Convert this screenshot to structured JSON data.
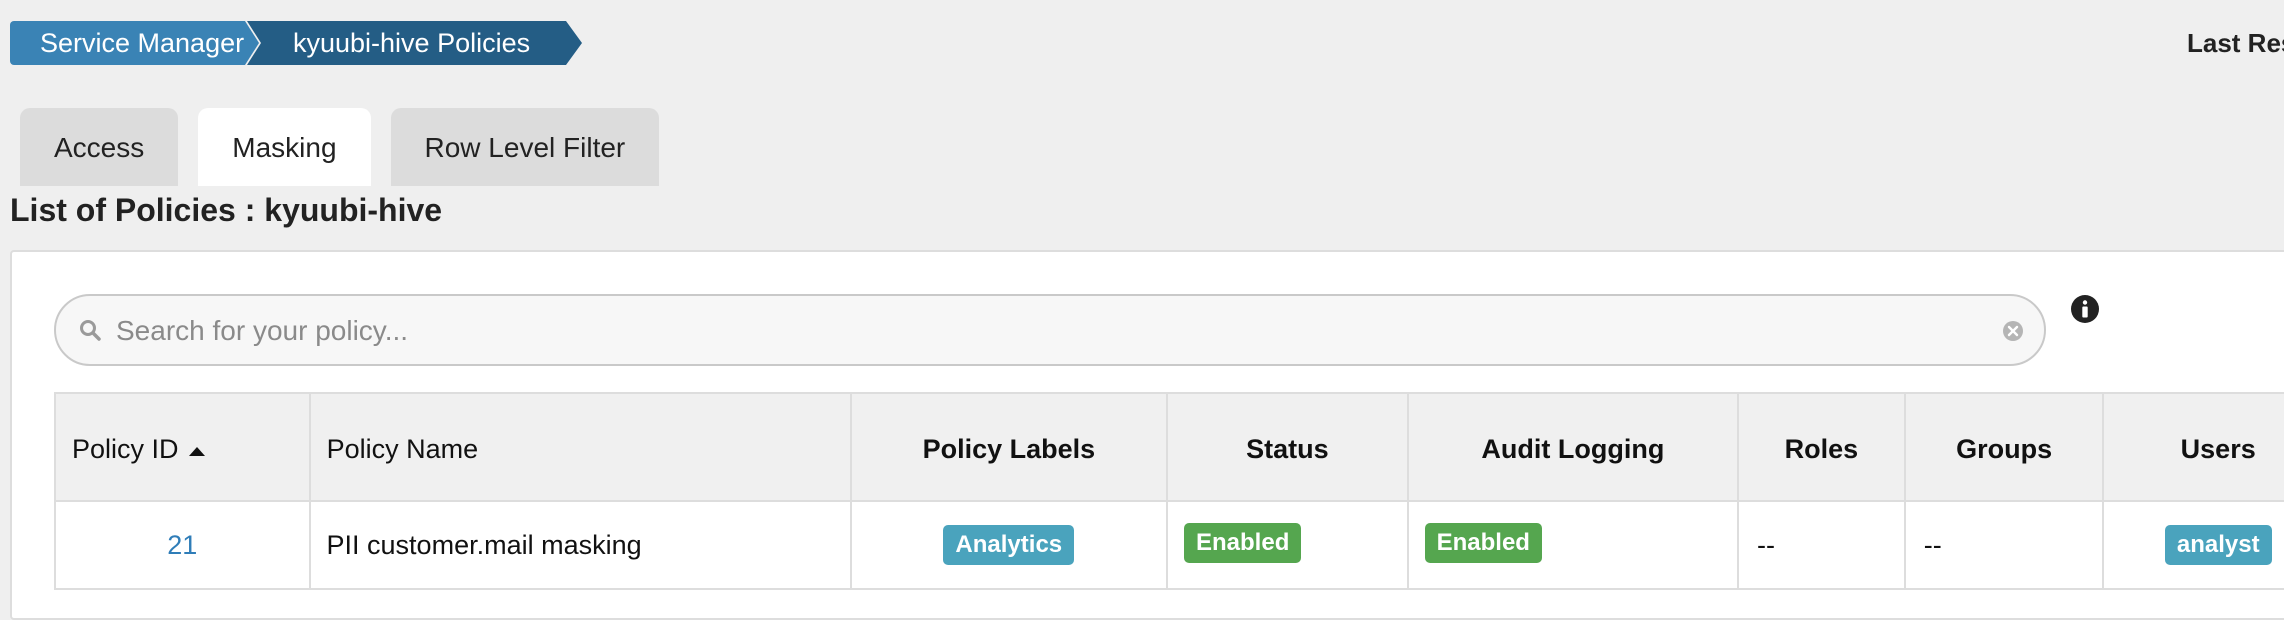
{
  "breadcrumb": {
    "items": [
      "Service Manager",
      "kyuubi-hive Policies"
    ]
  },
  "header": {
    "right_text": "Last Res"
  },
  "tabs": [
    {
      "label": "Access",
      "active": false
    },
    {
      "label": "Masking",
      "active": true
    },
    {
      "label": "Row Level Filter",
      "active": false
    }
  ],
  "list_title": "List of Policies : kyuubi-hive",
  "search": {
    "placeholder": "Search for your policy...",
    "value": ""
  },
  "table": {
    "headers": [
      "Policy ID",
      "Policy Name",
      "Policy Labels",
      "Status",
      "Audit Logging",
      "Roles",
      "Groups",
      "Users"
    ],
    "sort": {
      "column": "Policy ID",
      "direction": "ascending"
    },
    "rows": [
      {
        "policy_id": "21",
        "policy_name": "PII customer.mail masking",
        "policy_labels": "Analytics",
        "status": "Enabled",
        "audit_logging": "Enabled",
        "roles": "--",
        "groups": "--",
        "users": "analyst"
      }
    ]
  },
  "colors": {
    "crumb_primary": "#3a83b5",
    "crumb_secondary": "#245d85",
    "badge_info": "#4aa3bd",
    "badge_success": "#55a64f",
    "link": "#2f7db8"
  },
  "icons": [
    "search-icon",
    "clear-icon",
    "info-icon",
    "sort-ascending-icon"
  ]
}
